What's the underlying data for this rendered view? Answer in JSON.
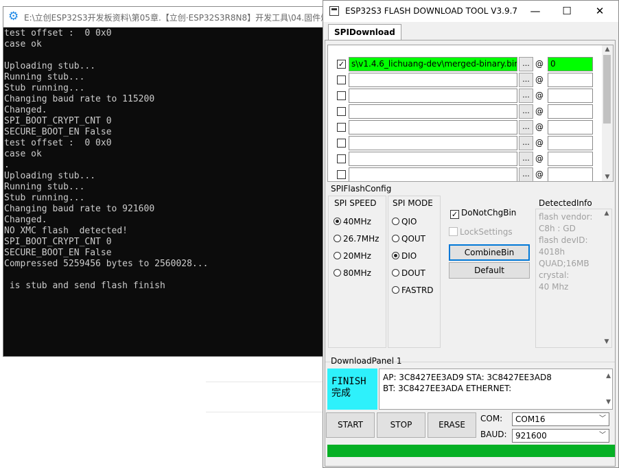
{
  "console": {
    "title": "E:\\立创ESP32S3开发板资料\\第05章.【立创·ESP32S3R8N8】开发工具\\04.固件烧录",
    "lines": [
      "test offset :  0 0x0",
      "case ok",
      "",
      "Uploading stub...",
      "Running stub...",
      "Stub running...",
      "Changing baud rate to 115200",
      "Changed.",
      "SPI_BOOT_CRYPT_CNT 0",
      "SECURE_BOOT_EN False",
      "test offset :  0 0x0",
      "case ok",
      ".",
      "Uploading stub...",
      "Running stub...",
      "Stub running...",
      "Changing baud rate to 921600",
      "Changed.",
      "NO XMC flash  detected!",
      "SPI_BOOT_CRYPT_CNT 0",
      "SECURE_BOOT_EN False",
      "Compressed 5259456 bytes to 2560028...",
      "",
      " is stub and send flash finish"
    ]
  },
  "tool": {
    "title": "ESP32S3 FLASH DOWNLOAD TOOL V3.9.7",
    "tab": "SPIDownload",
    "files": [
      {
        "checked": true,
        "path": "s\\v1.4.6_lichuang-dev\\merged-binary.bin",
        "addr": "0"
      },
      {
        "checked": false,
        "path": "",
        "addr": ""
      },
      {
        "checked": false,
        "path": "",
        "addr": ""
      },
      {
        "checked": false,
        "path": "",
        "addr": ""
      },
      {
        "checked": false,
        "path": "",
        "addr": ""
      },
      {
        "checked": false,
        "path": "",
        "addr": ""
      },
      {
        "checked": false,
        "path": "",
        "addr": ""
      },
      {
        "checked": false,
        "path": "",
        "addr": ""
      }
    ],
    "browse_label": "...",
    "at_label": "@",
    "spi_flash_config_label": "SPIFlashConfig",
    "spi_speed_label": "SPI SPEED",
    "spi_speeds": [
      "40MHz",
      "26.7MHz",
      "20MHz",
      "80MHz"
    ],
    "spi_speed_selected": 0,
    "spi_mode_label": "SPI MODE",
    "spi_modes": [
      "QIO",
      "QOUT",
      "DIO",
      "DOUT",
      "FASTRD"
    ],
    "spi_mode_selected": 2,
    "do_not_chg_bin": "DoNotChgBin",
    "lock_settings": "LockSettings",
    "combine_bin": "CombineBin",
    "default": "Default",
    "detected_info_label": "DetectedInfo",
    "detected_info": [
      "flash vendor:",
      "C8h : GD",
      "flash devID:",
      "4018h",
      "QUAD;16MB",
      "crystal:",
      "40 Mhz"
    ],
    "download_panel_label": "DownloadPanel 1",
    "status_en": "FINISH",
    "status_cn": "完成",
    "mac_line1": "AP:  3C8427EE3AD9  STA:  3C8427EE3AD8",
    "mac_line2": "BT:  3C8427EE3ADA  ETHERNET:",
    "start": "START",
    "stop": "STOP",
    "erase": "ERASE",
    "com_label": "COM:",
    "com_value": "COM16",
    "baud_label": "BAUD:",
    "baud_value": "921600",
    "progress": 1.0,
    "colors": {
      "finish": "#2ef1fb",
      "progress": "#06b025",
      "active_path": "#00ff00"
    }
  }
}
